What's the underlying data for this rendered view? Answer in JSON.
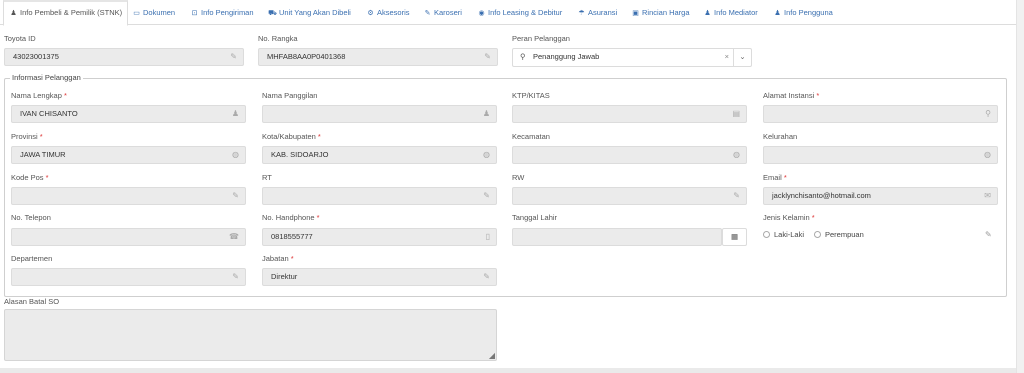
{
  "tabs": [
    {
      "label": "Info Pembeli & Pemilik (STNK)",
      "icon": "user-icon",
      "glyph": "♟"
    },
    {
      "label": "Dokumen",
      "icon": "folder-icon",
      "glyph": "▭"
    },
    {
      "label": "Info Pengiriman",
      "icon": "map-icon",
      "glyph": "⊡"
    },
    {
      "label": "Unit Yang Akan Dibeli",
      "icon": "car-icon",
      "glyph": "⛟"
    },
    {
      "label": "Aksesoris",
      "icon": "cogs-icon",
      "glyph": "⚙"
    },
    {
      "label": "Karoseri",
      "icon": "wrench-icon",
      "glyph": "✎"
    },
    {
      "label": "Info Leasing & Debitur",
      "icon": "eye-icon",
      "glyph": "◉"
    },
    {
      "label": "Asuransi",
      "icon": "umbrella-icon",
      "glyph": "☂"
    },
    {
      "label": "Rincian Harga",
      "icon": "money-icon",
      "glyph": "▣"
    },
    {
      "label": "Info Mediator",
      "icon": "users-icon",
      "glyph": "♟"
    },
    {
      "label": "Info Pengguna",
      "icon": "user-icon",
      "glyph": "♟"
    }
  ],
  "top": {
    "toyota_id_label": "Toyota ID",
    "toyota_id_value": "43023001375",
    "rangka_label": "No. Rangka",
    "rangka_value": "MHFAB8AA0P0401368",
    "peran_label": "Peran Pelanggan",
    "peran_value": "Penanggung Jawab",
    "clear_glyph": "×",
    "caret_glyph": "⌄"
  },
  "section": {
    "legend": "Informasi Pelanggan",
    "nama_lengkap_label": "Nama Lengkap",
    "nama_lengkap_value": "IVAN CHISANTO",
    "nama_panggilan_label": "Nama Panggilan",
    "nama_panggilan_value": "",
    "ktp_label": "KTP/KITAS",
    "ktp_value": "",
    "alamat_instansi_label": "Alamat Instansi",
    "alamat_instansi_value": "",
    "provinsi_label": "Provinsi",
    "provinsi_value": "JAWA TIMUR",
    "kota_label": "Kota/Kabupaten",
    "kota_value": "KAB. SIDOARJO",
    "kecamatan_label": "Kecamatan",
    "kecamatan_value": "",
    "kelurahan_label": "Kelurahan",
    "kelurahan_value": "",
    "kodepos_label": "Kode Pos",
    "kodepos_value": "",
    "rt_label": "RT",
    "rt_value": "",
    "rw_label": "RW",
    "rw_value": "",
    "email_label": "Email",
    "email_value": "jacklynchisanto@hotmail.com",
    "telepon_label": "No. Telepon",
    "telepon_value": "",
    "handphone_label": "No. Handphone",
    "handphone_value": "0818555777",
    "tgl_lahir_label": "Tanggal Lahir",
    "tgl_lahir_value": "",
    "jenis_kelamin_label": "Jenis Kelamin",
    "gender_options": [
      "Laki-Laki",
      "Perempuan"
    ],
    "departemen_label": "Departemen",
    "departemen_value": "",
    "jabatan_label": "Jabatan",
    "jabatan_value": "Direktur",
    "required_mark": "*"
  },
  "alasan_batal_label": "Alasan Batal SO",
  "alasan_batal_value": "",
  "colors": {
    "link": "#3a6fb0",
    "required": "#d33333",
    "field_bg": "#ebebeb"
  }
}
